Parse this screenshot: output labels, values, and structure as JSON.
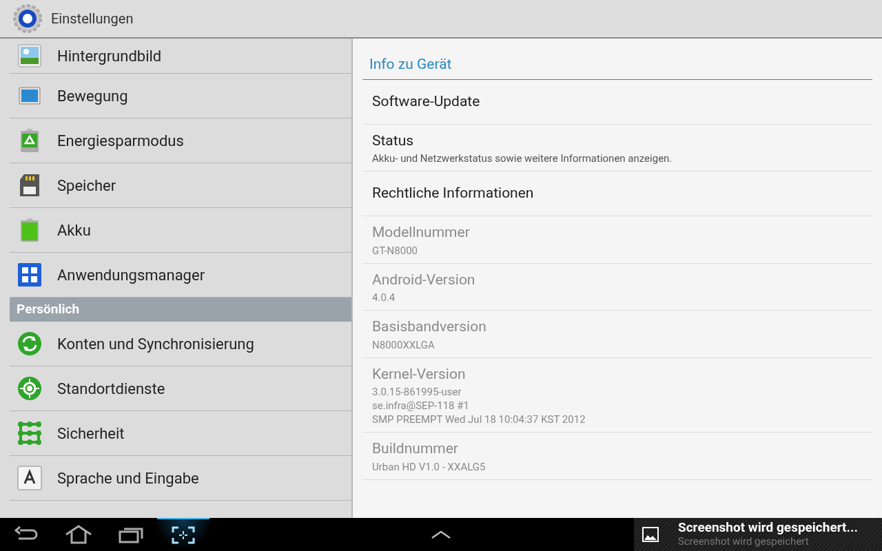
{
  "action_bar": {
    "title": "Einstellungen"
  },
  "sidebar": {
    "items": [
      {
        "kind": "item",
        "label": "Hintergrundbild"
      },
      {
        "kind": "item",
        "label": "Bewegung"
      },
      {
        "kind": "item",
        "label": "Energiesparmodus"
      },
      {
        "kind": "item",
        "label": "Speicher"
      },
      {
        "kind": "item",
        "label": "Akku"
      },
      {
        "kind": "item",
        "label": "Anwendungsmanager"
      },
      {
        "kind": "header",
        "label": "Persönlich"
      },
      {
        "kind": "item",
        "label": "Konten und Synchronisierung"
      },
      {
        "kind": "item",
        "label": "Standortdienste"
      },
      {
        "kind": "item",
        "label": "Sicherheit"
      },
      {
        "kind": "item",
        "label": "Sprache und Eingabe"
      }
    ]
  },
  "details": {
    "title": "Info zu Gerät",
    "items": [
      {
        "title": "Software-Update",
        "disabled": false
      },
      {
        "title": "Status",
        "summary": [
          "Akku- und Netzwerkstatus sowie weitere Informationen anzeigen."
        ],
        "disabled": false
      },
      {
        "title": "Rechtliche Informationen",
        "disabled": false
      },
      {
        "title": "Modellnummer",
        "summary": [
          "GT-N8000"
        ],
        "disabled": true
      },
      {
        "title": "Android-Version",
        "summary": [
          "4.0.4"
        ],
        "disabled": true
      },
      {
        "title": "Basisbandversion",
        "summary": [
          "N8000XXLGA"
        ],
        "disabled": true
      },
      {
        "title": "Kernel-Version",
        "summary": [
          "3.0.15-861995-user",
          "se.infra@SEP-118 #1",
          "SMP PREEMPT Wed Jul 18 10:04:37 KST 2012"
        ],
        "disabled": true
      },
      {
        "title": "Buildnummer",
        "summary": [
          "Urban HD V1.0 - XXALG5"
        ],
        "disabled": true
      }
    ]
  },
  "notification": {
    "title": "Screenshot wird gespeichert...",
    "text": "Screenshot wird gespeichert"
  }
}
